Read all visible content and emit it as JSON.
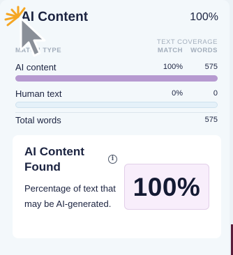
{
  "header": {
    "title": "AI Content",
    "percent": "100%"
  },
  "columns": {
    "group": "TEXT COVERAGE",
    "type": "MATCH TYPE",
    "match": "MATCH",
    "words": "WORDS"
  },
  "rows": [
    {
      "label": "AI content",
      "match": "100%",
      "words": "575",
      "fill_fraction": 1.0
    },
    {
      "label": "Human text",
      "match": "0%",
      "words": "0",
      "fill_fraction": 0.0
    }
  ],
  "total": {
    "label": "Total words",
    "words": "575"
  },
  "card": {
    "title": "AI Content Found",
    "description": "Percentage of text that may be AI-generated.",
    "big_percent": "100%",
    "info_icon": "info-icon"
  },
  "colors": {
    "ai_bar": "#b69ad0",
    "human_bar": "#a9d0ea",
    "accent_box": "#f8eefb"
  },
  "cursor": {
    "icon": "arrow-pointer-icon",
    "click_burst": "click-burst-icon"
  }
}
